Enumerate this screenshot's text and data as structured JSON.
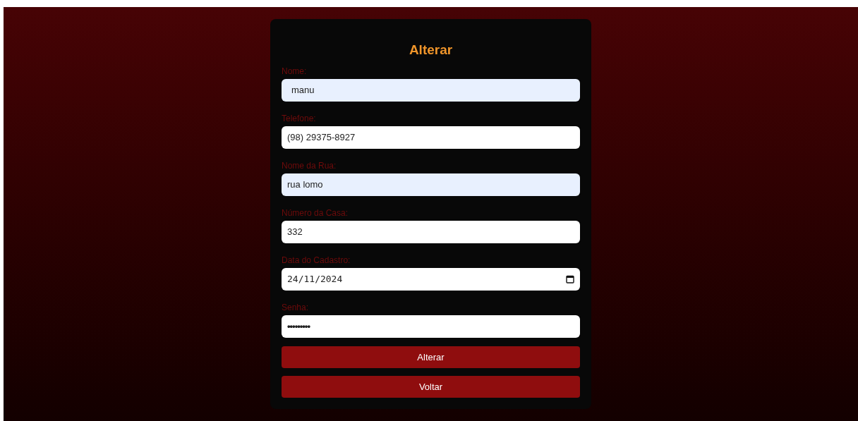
{
  "form": {
    "title": "Alterar",
    "fields": [
      {
        "label": "Nome:",
        "kind": "text",
        "value": "manu",
        "autofilled": true
      },
      {
        "label": "Telefone:",
        "kind": "text",
        "value": "(98) 29375-8927",
        "autofilled": false
      },
      {
        "label": "Nome da Rua:",
        "kind": "text",
        "value": "rua lomo",
        "autofilled": true
      },
      {
        "label": "Número da Casa:",
        "kind": "text",
        "value": "332",
        "autofilled": false
      },
      {
        "label": "Data do Cadastro:",
        "kind": "date",
        "value": "24/11/2024",
        "autofilled": false
      },
      {
        "label": "Senha:",
        "kind": "password",
        "value": "•••••••••",
        "autofilled": false
      }
    ],
    "buttons": [
      "Alterar",
      "Voltar"
    ]
  }
}
